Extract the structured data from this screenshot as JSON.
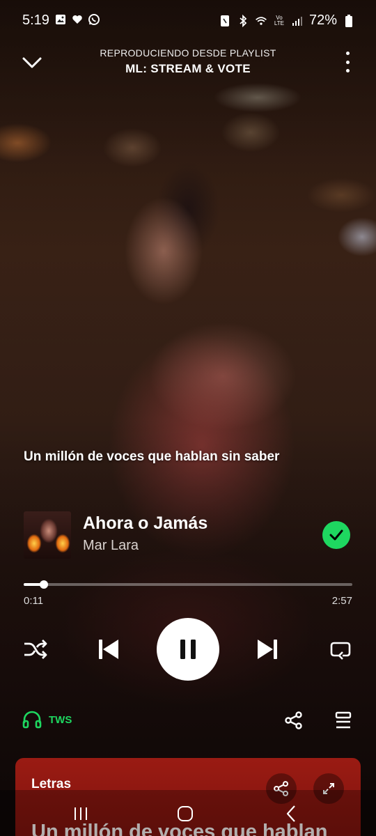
{
  "status_bar": {
    "time": "5:19",
    "battery": "72%",
    "left_icons": [
      "gallery-icon",
      "heart-icon",
      "whatsapp-icon"
    ],
    "right_icons": [
      "nfc-icon",
      "bluetooth-icon",
      "wifi-icon",
      "volte-icon",
      "signal-icon",
      "battery-icon"
    ]
  },
  "header": {
    "subtitle": "REPRODUCIENDO DESDE PLAYLIST",
    "title": "ML: STREAM & VOTE"
  },
  "lyric_overlay": "Un millón de voces que hablan sin saber",
  "track": {
    "title": "Ahora o Jamás",
    "artist": "Mar Lara",
    "liked": true
  },
  "progress": {
    "elapsed": "0:11",
    "total": "2:57",
    "fraction": 0.062
  },
  "controls": {
    "shuffle": "shuffle-icon",
    "previous": "skip-previous-icon",
    "play_state": "pause-icon",
    "next": "skip-next-icon",
    "repeat": "repeat-icon"
  },
  "device": {
    "label": "TWS",
    "icon": "headphones-icon"
  },
  "lyrics_card": {
    "label": "Letras",
    "preview": "Un millón de voces que hablan"
  },
  "colors": {
    "accent_green": "#1ed760",
    "lyrics_card": "#8f1811"
  }
}
